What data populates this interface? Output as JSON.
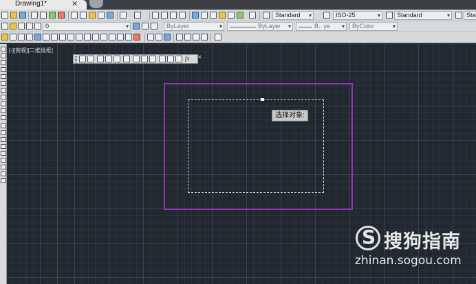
{
  "tab": {
    "title": "Drawing1*",
    "close": "✕"
  },
  "toolbar": {
    "text_style": "Standard",
    "dim_style": "ISO-25",
    "table_style": "Standard",
    "overflow_label": "Sta",
    "layer": "0",
    "color": "ByLayer",
    "linetype": "ByLayer",
    "lineweight": "B...ye",
    "plot_style": "ByColor",
    "lineweight_suffix": "ye"
  },
  "viewport": {
    "label": "[-][俯视][二维线框]"
  },
  "float_toolbar": {
    "fx_label": "fx"
  },
  "prompt": {
    "tooltip": "选择对象:"
  },
  "watermark": {
    "brand": "搜狗指南",
    "url": "zhinan.sogou.com",
    "logo_letter": "S"
  }
}
